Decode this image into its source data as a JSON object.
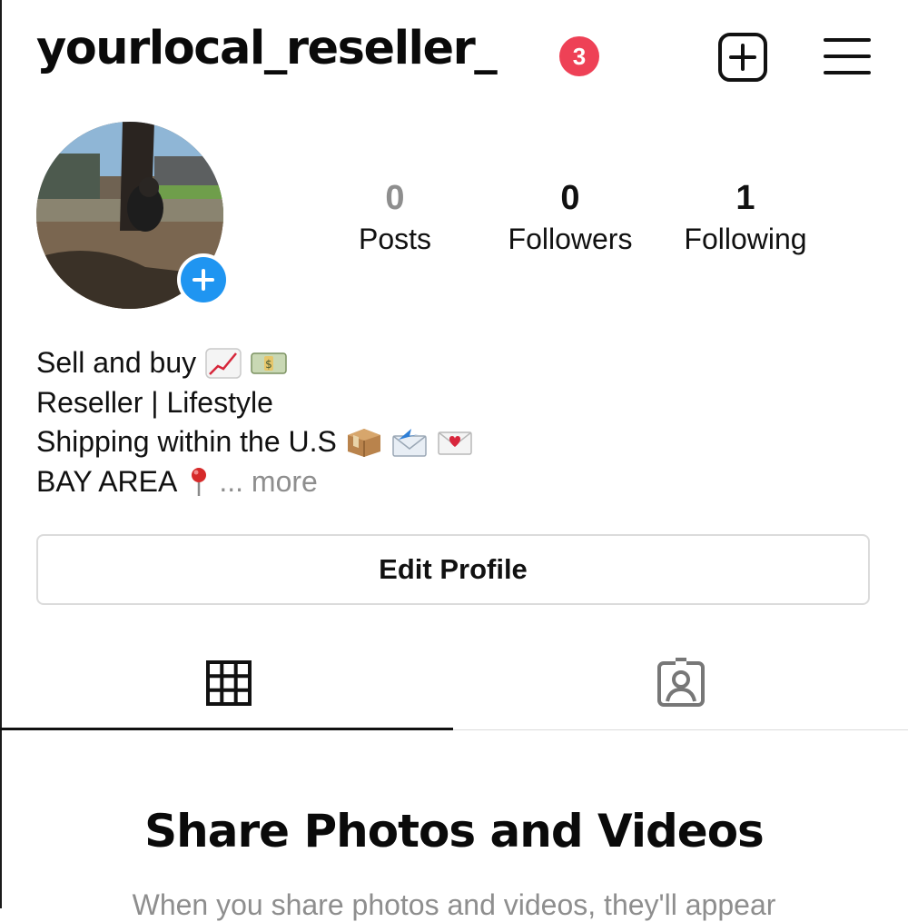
{
  "header": {
    "username": "yourlocal_reseller_",
    "notification_count": "3",
    "create_icon": "plus-square-icon",
    "menu_icon": "hamburger-menu-icon"
  },
  "profile": {
    "avatar_icon": "profile-photo",
    "add_story_icon": "plus-icon",
    "stats": [
      {
        "value": "0",
        "label": "Posts"
      },
      {
        "value": "0",
        "label": "Followers"
      },
      {
        "value": "1",
        "label": "Following"
      }
    ]
  },
  "bio": {
    "line1": "Sell and buy",
    "line2": "Reseller | Lifestyle",
    "line3": "Shipping within the U.S",
    "line4": "BAY AREA",
    "more": "... more",
    "emoji_icons": [
      "chart-increasing-icon",
      "dollar-banknote-icon",
      "package-icon",
      "envelope-with-arrow-icon",
      "love-letter-icon",
      "round-pushpin-icon"
    ]
  },
  "actions": {
    "edit_profile": "Edit Profile"
  },
  "tabs": [
    {
      "name": "grid",
      "icon": "grid-icon",
      "active": true
    },
    {
      "name": "tagged",
      "icon": "tagged-person-icon",
      "active": false
    }
  ],
  "empty_state": {
    "title": "Share Photos and Videos",
    "subtitle": "When you share photos and videos, they'll appear"
  },
  "colors": {
    "badge": "#ee4156",
    "accent_blue": "#1f95f1",
    "muted": "#8e8e8e",
    "border": "#dbdbdb"
  }
}
